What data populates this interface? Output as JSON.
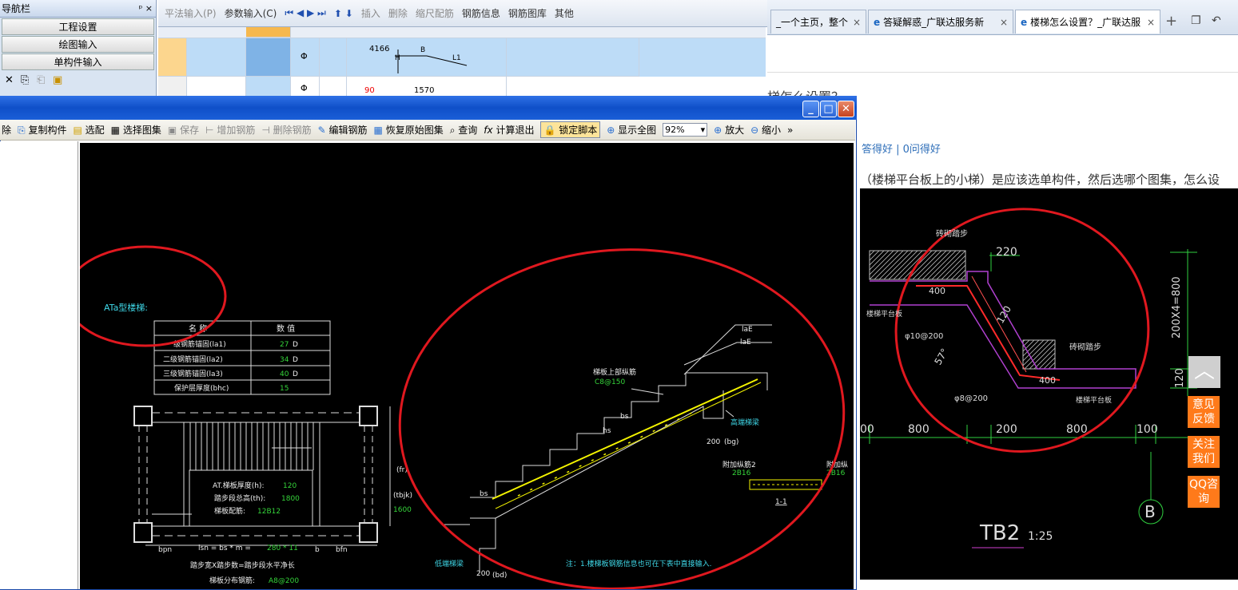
{
  "nav": {
    "title": "导航栏",
    "pin": "ᵖ ×",
    "items": [
      "工程设置",
      "绘图输入",
      "单构件输入"
    ]
  },
  "topbar": {
    "items": [
      "平法输入(P)",
      "参数输入(C)",
      "插入",
      "删除",
      "缩尺配筋",
      "钢筋信息",
      "钢筋图库",
      "其他"
    ]
  },
  "grid": {
    "row1": {
      "bar": "Φ",
      "dim1": "4166",
      "h": "H",
      "b": "B",
      "l1": "L1"
    },
    "row2": {
      "bar": "Φ",
      "dim1": "90",
      "dim2": "1570"
    }
  },
  "browser": {
    "tabs": [
      {
        "label": "_一个主页，整个"
      },
      {
        "label": "答疑解惑_广联达服务新"
      },
      {
        "label": "楼梯怎么设置？_广联达服"
      }
    ],
    "heading": "梯怎么设置？",
    "links": "答得好 | 0问得好",
    "question": "（楼梯平台板上的小梯）是应该选单构件，然后选哪个图集，怎么设",
    "side_feedback": "意见反馈",
    "side_follow": "关注我们",
    "side_qq": "QQ咨询",
    "drawing": {
      "label_top": "砖砌踏步",
      "dim_220": "220",
      "dim_400a": "400",
      "label_left": "楼梯平台板",
      "rebar1": "φ10@200",
      "dim_120a": "120",
      "angle": "57°",
      "label_mid": "砖砌踏步",
      "dim_400b": "400",
      "rebar2": "φ8@200",
      "label_right": "楼梯平台板",
      "vertical_dim": "200X4=800",
      "vertical_120": "120",
      "bottom_dims": [
        "00",
        "800",
        "200",
        "800",
        "100"
      ],
      "axis": "B",
      "title": "TB2",
      "scale": "1:25"
    }
  },
  "dialog": {
    "toolbar": {
      "delete": "除",
      "copy": "复制构件",
      "select": "选配",
      "select_atlas": "选择图集",
      "save": "保存",
      "add_rebar": "增加钢筋",
      "delete_rebar": "删除钢筋",
      "edit_rebar": "编辑钢筋",
      "restore": "恢复原始图集",
      "query": "查询",
      "calc_exit": "计算退出",
      "lock": "锁定脚本",
      "show_all": "显示全图",
      "zoom": "92%",
      "zoom_in": "放大",
      "zoom_out": "缩小",
      "more": "»"
    },
    "cad": {
      "type_label": "ATa型楼梯:",
      "table_headers": [
        "名  称",
        "数  值"
      ],
      "table_rows": [
        {
          "name": "一级钢筋锚固(la1)",
          "value": "27",
          "unit": "D"
        },
        {
          "name": "二级钢筋锚固(la2)",
          "value": "34",
          "unit": "D"
        },
        {
          "name": "三级钢筋锚固(la3)",
          "value": "40",
          "unit": "D"
        },
        {
          "name": "保护层厚度(bhc)",
          "value": "15",
          "unit": ""
        }
      ],
      "plan": {
        "thickness_label": "AT.梯板厚度(h):",
        "thickness": "120",
        "height_label": "踏步段总高(th):",
        "height": "1800",
        "rebar_label": "梯板配筋:",
        "rebar": "12B12",
        "fr": "(fr)",
        "tbjk": "(tbjk)",
        "v1600": "1600",
        "bpn": "bpn",
        "lsn": "lsn = bs * m =",
        "lsn_val": "280 * 11",
        "b": "b",
        "bfn": "bfn",
        "step_note": "踏步宽X踏步数=踏步段水平净长",
        "dist_label": "梯板分布钢筋:",
        "dist": "A8@200"
      },
      "section": {
        "lae1": "laE",
        "lae2": "laE",
        "upper_label": "梯板上部纵筋",
        "upper": "C8@150",
        "bs": "bs",
        "hs": "hs",
        "high_beam": "高端梯梁",
        "bg": "200",
        "bg_label": "(bg)",
        "extra2_label": "附加纵筋2",
        "extra2": "2B16",
        "extra1_label": "附加纵",
        "extra1": "2B16",
        "section_mark": "1-1",
        "bs_low": "bs",
        "low_beam": "低端梯梁",
        "bd": "200",
        "bd_label": "(bd)",
        "note": "注：1.楼梯板钢筋信息也可在下表中直接输入."
      }
    }
  },
  "colors": {
    "annotation_red": "#e0181f",
    "cad_cyan": "#3fd8e8",
    "cad_green": "#35d43a",
    "cad_yellow": "#f4f400",
    "selection_blue": "#bddcf7"
  }
}
